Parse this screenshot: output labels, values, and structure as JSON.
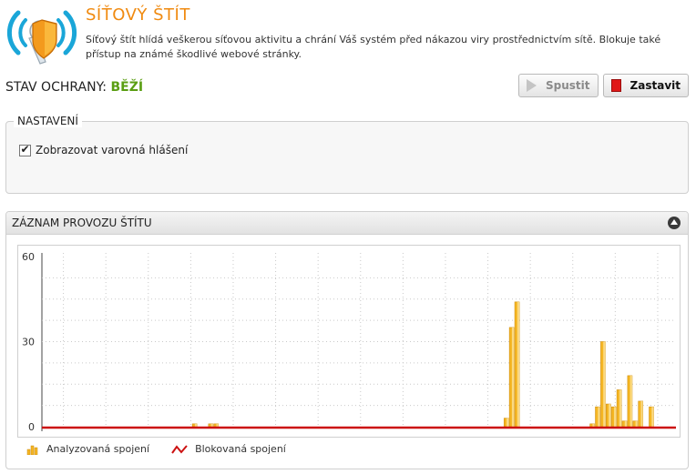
{
  "header": {
    "title": "SÍŤOVÝ ŠTÍT",
    "description": "Síťový štít hlídá veškerou síťovou aktivitu a chrání Váš systém před nákazou viry prostřednictvím sítě. Blokuje také přístup na známé škodlivé webové stránky.",
    "logo_icon": "network-shield-icon"
  },
  "status": {
    "label": "STAV OCHRANY:",
    "value": "BĚŽÍ",
    "value_color": "#5a9e13"
  },
  "toolbar": {
    "start_label": "Spustit",
    "stop_label": "Zastavit"
  },
  "settings": {
    "title": "NASTAVENÍ",
    "show_warnings_label": "Zobrazovat varovná hlášení",
    "show_warnings_checked": true
  },
  "log": {
    "title": "ZÁZNAM PROVOZU ŠTÍTU",
    "collapse_icon": "collapse-up-icon"
  },
  "chart_data": {
    "type": "bar",
    "title": "",
    "xlabel": "",
    "ylabel": "",
    "ylim": [
      0,
      60
    ],
    "yticks": [
      "60",
      "30",
      "0"
    ],
    "grid": true,
    "legend_position": "bottom-left",
    "categories_count": 118,
    "series": [
      {
        "name": "Analyzovaná spojení",
        "kind": "bar",
        "color": "#f5b623",
        "points": [
          {
            "i": 28,
            "v": 1
          },
          {
            "i": 31,
            "v": 1
          },
          {
            "i": 32,
            "v": 1
          },
          {
            "i": 86,
            "v": 3
          },
          {
            "i": 87,
            "v": 35
          },
          {
            "i": 88,
            "v": 44
          },
          {
            "i": 102,
            "v": 1
          },
          {
            "i": 103,
            "v": 7
          },
          {
            "i": 104,
            "v": 30
          },
          {
            "i": 105,
            "v": 8
          },
          {
            "i": 106,
            "v": 7
          },
          {
            "i": 107,
            "v": 13
          },
          {
            "i": 108,
            "v": 2
          },
          {
            "i": 109,
            "v": 18
          },
          {
            "i": 110,
            "v": 2
          },
          {
            "i": 111,
            "v": 9
          },
          {
            "i": 113,
            "v": 7
          }
        ]
      },
      {
        "name": "Blokovaná spojení",
        "kind": "line",
        "color": "#cc1111",
        "value": 0
      }
    ]
  }
}
